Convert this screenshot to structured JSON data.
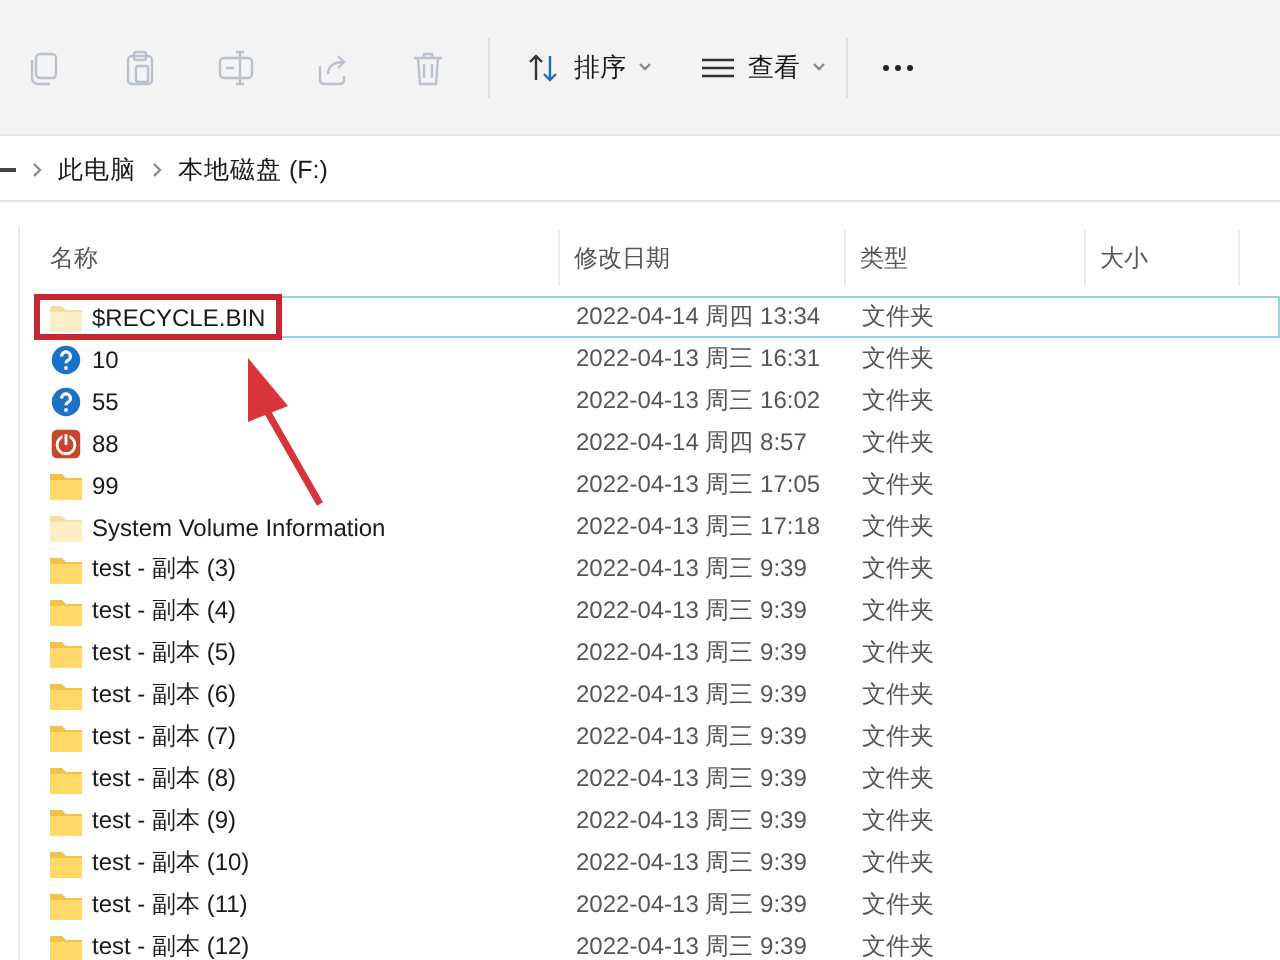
{
  "toolbar": {
    "actions": [
      {
        "kind": "copy",
        "disabled": true
      },
      {
        "kind": "paste",
        "disabled": true
      },
      {
        "kind": "rename",
        "disabled": true
      },
      {
        "kind": "share",
        "disabled": true
      },
      {
        "kind": "delete",
        "disabled": true
      }
    ],
    "sort": {
      "label": "排序"
    },
    "view": {
      "label": "查看"
    }
  },
  "breadcrumb": [
    "此电脑",
    "本地磁盘 (F:)"
  ],
  "table": {
    "columns": [
      "名称",
      "修改日期",
      "类型",
      "大小"
    ],
    "rows": [
      {
        "name": "$RECYCLE.BIN",
        "kind": "folder-hidden",
        "date": "2022-04-14 周四 13:34",
        "type": "文件夹",
        "focused": true,
        "highlighted": true
      },
      {
        "name": "10",
        "kind": "unknown",
        "date": "2022-04-13 周三 16:31",
        "type": "文件夹",
        "focused": false,
        "highlighted": false
      },
      {
        "name": "55",
        "kind": "unknown",
        "date": "2022-04-13 周三 16:02",
        "type": "文件夹",
        "focused": false,
        "highlighted": false
      },
      {
        "name": "88",
        "kind": "app",
        "date": "2022-04-14 周四 8:57",
        "type": "文件夹",
        "focused": false,
        "highlighted": false
      },
      {
        "name": "99",
        "kind": "folder",
        "date": "2022-04-13 周三 17:05",
        "type": "文件夹",
        "focused": false,
        "highlighted": false
      },
      {
        "name": "System Volume Information",
        "kind": "folder-hidden",
        "date": "2022-04-13 周三 17:18",
        "type": "文件夹",
        "focused": false,
        "highlighted": false
      },
      {
        "name": "test - 副本 (3)",
        "kind": "folder",
        "date": "2022-04-13 周三 9:39",
        "type": "文件夹",
        "focused": false,
        "highlighted": false
      },
      {
        "name": "test - 副本 (4)",
        "kind": "folder",
        "date": "2022-04-13 周三 9:39",
        "type": "文件夹",
        "focused": false,
        "highlighted": false
      },
      {
        "name": "test - 副本 (5)",
        "kind": "folder",
        "date": "2022-04-13 周三 9:39",
        "type": "文件夹",
        "focused": false,
        "highlighted": false
      },
      {
        "name": "test - 副本 (6)",
        "kind": "folder",
        "date": "2022-04-13 周三 9:39",
        "type": "文件夹",
        "focused": false,
        "highlighted": false
      },
      {
        "name": "test - 副本 (7)",
        "kind": "folder",
        "date": "2022-04-13 周三 9:39",
        "type": "文件夹",
        "focused": false,
        "highlighted": false
      },
      {
        "name": "test - 副本 (8)",
        "kind": "folder",
        "date": "2022-04-13 周三 9:39",
        "type": "文件夹",
        "focused": false,
        "highlighted": false
      },
      {
        "name": "test - 副本 (9)",
        "kind": "folder",
        "date": "2022-04-13 周三 9:39",
        "type": "文件夹",
        "focused": false,
        "highlighted": false
      },
      {
        "name": "test - 副本 (10)",
        "kind": "folder",
        "date": "2022-04-13 周三 9:39",
        "type": "文件夹",
        "focused": false,
        "highlighted": false
      },
      {
        "name": "test - 副本 (11)",
        "kind": "folder",
        "date": "2022-04-13 周三 9:39",
        "type": "文件夹",
        "focused": false,
        "highlighted": false
      },
      {
        "name": "test - 副本 (12)",
        "kind": "folder",
        "date": "2022-04-13 周三 9:39",
        "type": "文件夹",
        "focused": false,
        "highlighted": false
      }
    ]
  }
}
